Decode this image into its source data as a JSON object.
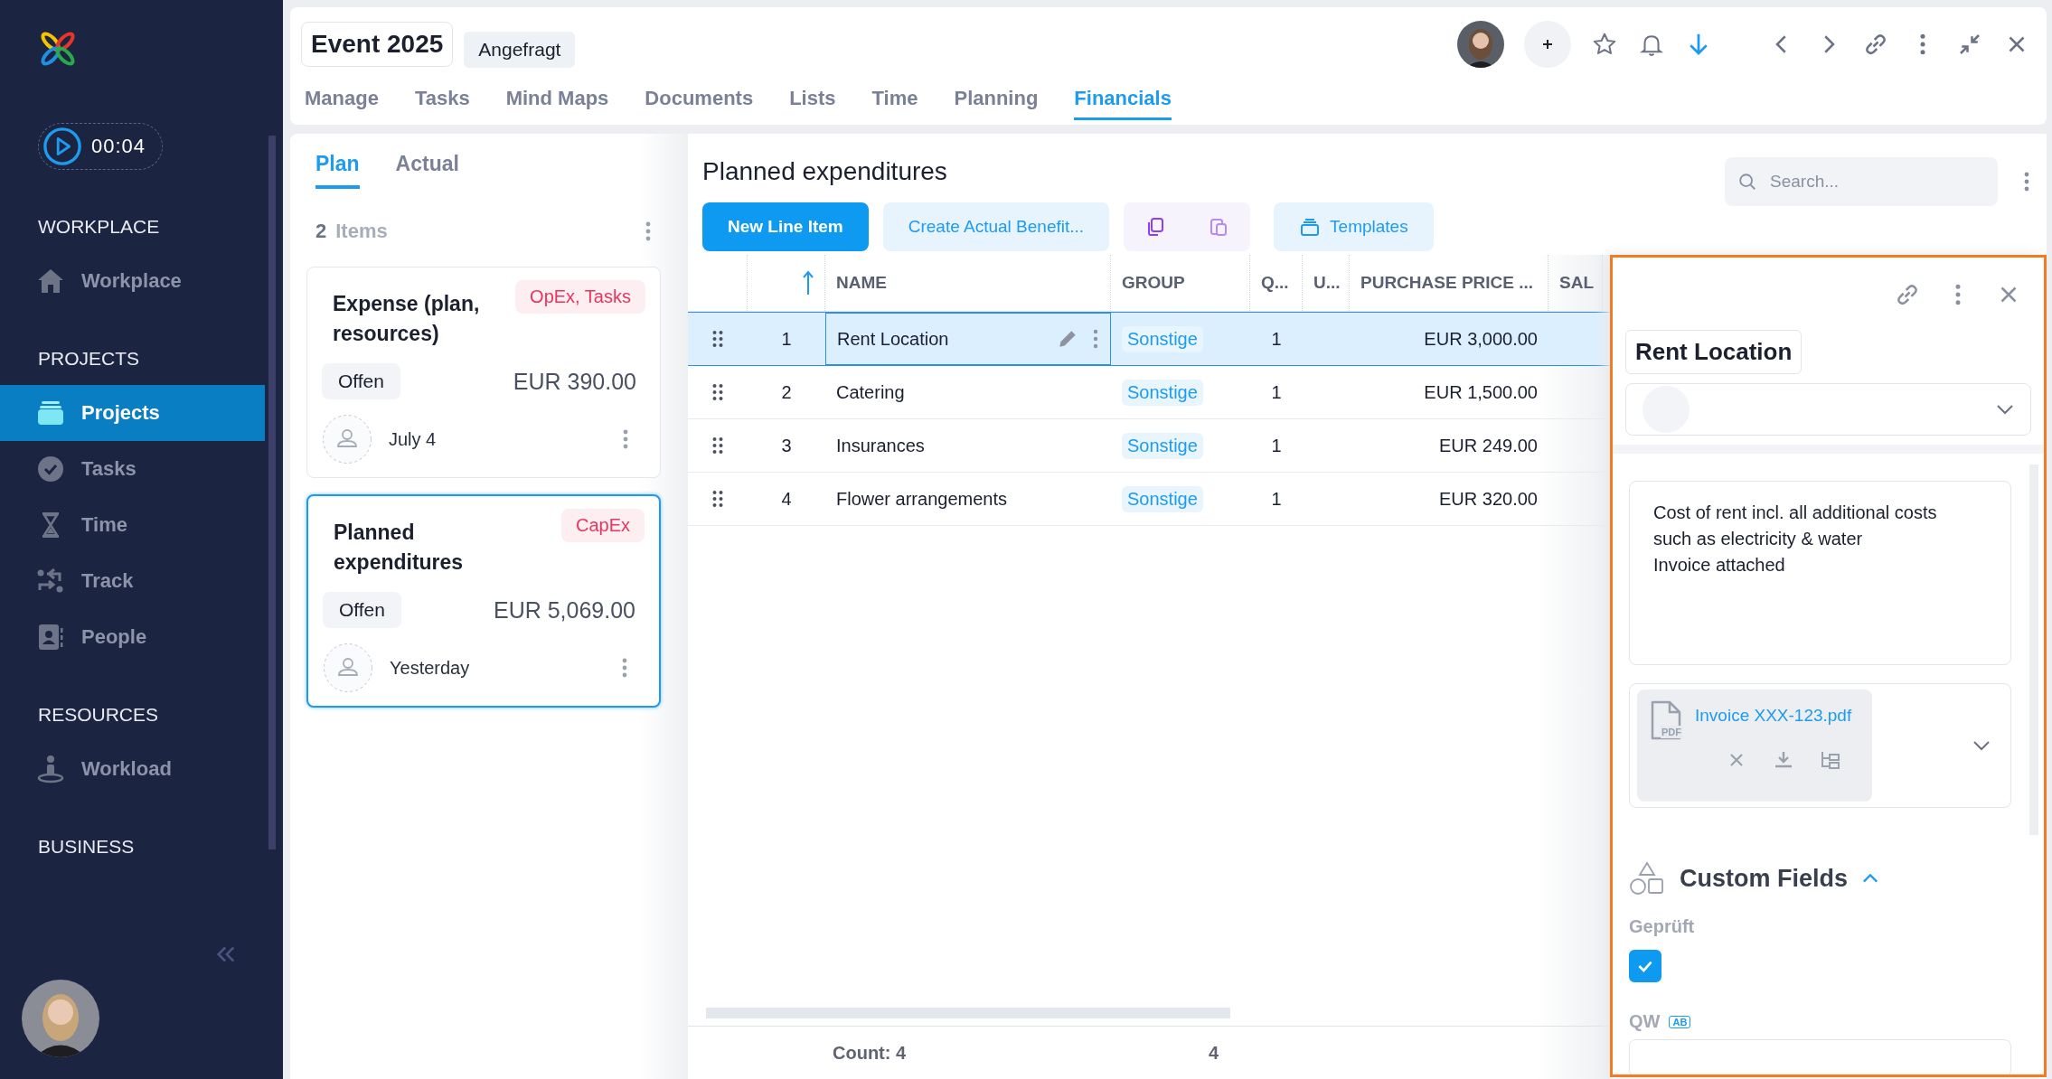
{
  "sidebar": {
    "timer": "00:04",
    "sections": [
      {
        "title": "WORKPLACE",
        "items": [
          {
            "label": "Workplace",
            "kind": "home",
            "selected": false
          }
        ]
      },
      {
        "title": "PROJECTS",
        "items": [
          {
            "label": "Projects",
            "kind": "folder",
            "selected": true
          },
          {
            "label": "Tasks",
            "kind": "check",
            "selected": false
          },
          {
            "label": "Time",
            "kind": "hourglass",
            "selected": false
          },
          {
            "label": "Track",
            "kind": "track",
            "selected": false
          },
          {
            "label": "People",
            "kind": "people",
            "selected": false
          }
        ]
      },
      {
        "title": "RESOURCES",
        "items": [
          {
            "label": "Workload",
            "kind": "workload",
            "selected": false
          }
        ]
      },
      {
        "title": "BUSINESS"
      }
    ]
  },
  "header": {
    "title": "Event 2025",
    "status": "Angefragt",
    "tabs": [
      {
        "label": "Manage",
        "selected": false
      },
      {
        "label": "Tasks",
        "selected": false
      },
      {
        "label": "Mind Maps",
        "selected": false
      },
      {
        "label": "Documents",
        "selected": false
      },
      {
        "label": "Lists",
        "selected": false
      },
      {
        "label": "Time",
        "selected": false
      },
      {
        "label": "Planning",
        "selected": false
      },
      {
        "label": "Financials",
        "selected": true
      }
    ]
  },
  "plans": {
    "tabs": [
      {
        "label": "Plan",
        "selected": true
      },
      {
        "label": "Actual",
        "selected": false
      }
    ],
    "count": "2",
    "count_label": "Items",
    "cards": [
      {
        "title": "Expense (plan, resources)",
        "tag": "OpEx, Tasks",
        "status": "Offen",
        "amount": "EUR 390.00",
        "date": "July 4",
        "selected": false
      },
      {
        "title": "Planned expenditures",
        "tag": "CapEx",
        "status": "Offen",
        "amount": "EUR 5,069.00",
        "date": "Yesterday",
        "selected": true
      }
    ]
  },
  "table": {
    "title": "Planned expenditures",
    "search": {
      "placeholder": "Search..."
    },
    "buttons": [
      {
        "label": "New Line Item",
        "kind": "primary"
      },
      {
        "label": "Create Actual Benefit...",
        "kind": "secondary"
      },
      {
        "label": "Templates",
        "kind": "templates"
      }
    ],
    "columns": [
      "NAME",
      "GROUP",
      "Q...",
      "U...",
      "PURCHASE PRICE ...",
      "SAL"
    ],
    "rows": [
      {
        "number": "1",
        "name": "Rent Location",
        "group": "Sonstige",
        "quantity": "1",
        "purchase_price": "EUR 3,000.00",
        "selected": true
      },
      {
        "number": "2",
        "name": "Catering",
        "group": "Sonstige",
        "quantity": "1",
        "purchase_price": "EUR 1,500.00",
        "selected": false
      },
      {
        "number": "3",
        "name": "Insurances",
        "group": "Sonstige",
        "quantity": "1",
        "purchase_price": "EUR 249.00",
        "selected": false
      },
      {
        "number": "4",
        "name": "Flower arrangements",
        "group": "Sonstige",
        "quantity": "1",
        "purchase_price": "EUR 320.00",
        "selected": false
      }
    ],
    "footer": {
      "count": "Count: 4",
      "quantity_total": "4"
    }
  },
  "detail": {
    "title": "Rent Location",
    "description": "Cost of rent incl. all additional costs\nsuch as electricity & water\nInvoice attached",
    "attachment": {
      "file_type": "PDF",
      "name": "Invoice XXX-123.pdf"
    },
    "custom_fields": {
      "heading": "Custom Fields",
      "expanded": true,
      "fields": [
        {
          "label": "Geprüft",
          "kind": "checkbox",
          "checked": true
        },
        {
          "label": "QW",
          "kind": "text",
          "badge": "AB"
        }
      ]
    }
  }
}
